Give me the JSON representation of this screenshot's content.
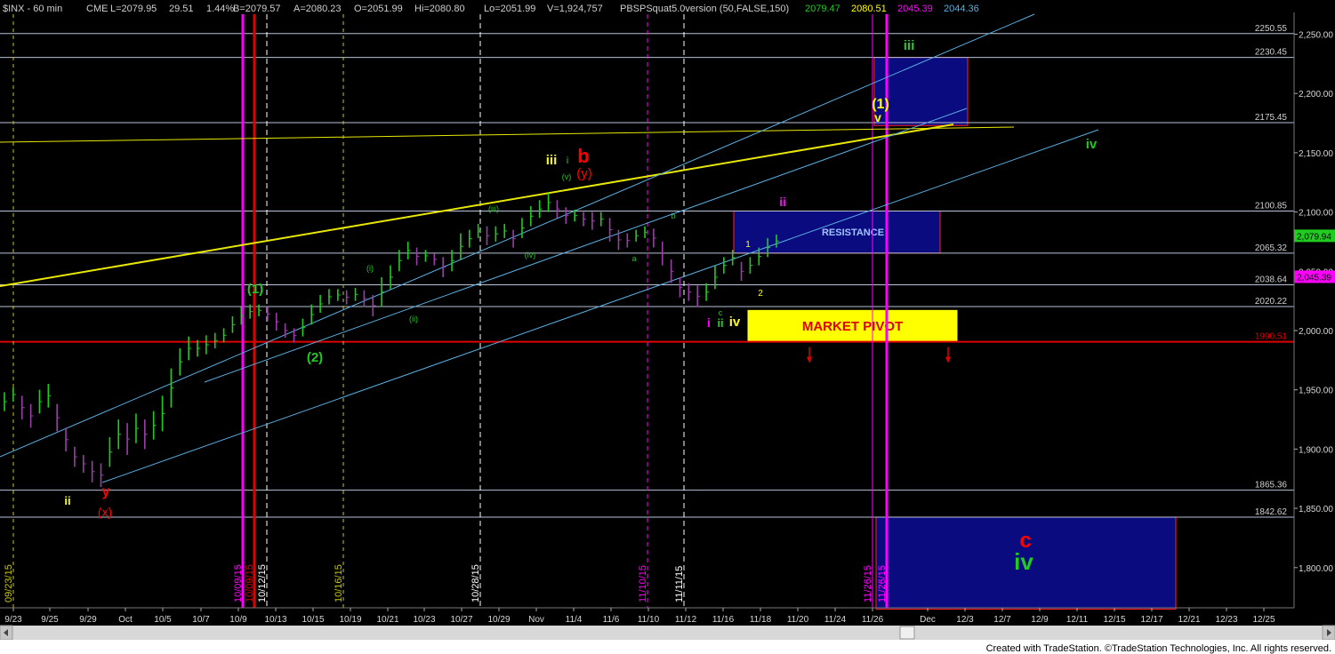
{
  "header": {
    "symbol": "$INX - 60 min",
    "exchange": "CME",
    "last": "L=2079.95",
    "change": "29.51",
    "pct": "1.44%",
    "bid": "B=2079.57",
    "ask": "A=2080.23",
    "open": "O=2051.99",
    "hi": "Hi=2080.80",
    "lo": "Lo=2051.99",
    "volume": "V=1,924,757",
    "indicator": "PBSPSquat5.0version (50,FALSE,150)",
    "ind_values": [
      "2079.47",
      "2080.51",
      "2045.39",
      "2044.36"
    ]
  },
  "footer": "Created with TradeStation. ©TradeStation Technologies, Inc. All rights reserved.",
  "colors": {
    "background": "#000000",
    "price_up": "#1fcc1f",
    "price_down": "#9a3fa8",
    "level_line": "#b8c4d6",
    "red_line": "#e00000",
    "channel": "#5aaee0",
    "yellow": "#ffff00",
    "magenta": "#ff00ff",
    "box_fill": "#0b0b80",
    "box_border": "#ff2020"
  },
  "chart_data": {
    "type": "candlestick",
    "title": "$INX - 60 min",
    "ylim": [
      1762,
      2270
    ],
    "y_ticks": [
      "2,250.00",
      "2,200.00",
      "2,150.00",
      "2,100.00",
      "2,050.00",
      "2,000.00",
      "1,950.00",
      "1,900.00",
      "1,850.00",
      "1,800.00"
    ],
    "x_ticks": [
      "9/23",
      "9/25",
      "9/29",
      "Oct",
      "10/5",
      "10/7",
      "10/9",
      "10/13",
      "10/15",
      "10/19",
      "10/21",
      "10/23",
      "10/27",
      "10/29",
      "Nov",
      "11/4",
      "11/6",
      "11/10",
      "11/12",
      "11/16",
      "11/18",
      "11/20",
      "11/24",
      "11/26",
      "Dec",
      "12/3",
      "12/7",
      "12/9",
      "12/11",
      "12/15",
      "12/17",
      "12/21",
      "12/23",
      "12/25"
    ],
    "horizontal_levels": [
      {
        "value": 2250.55,
        "label": "2250.55"
      },
      {
        "value": 2230.45,
        "label": "2230.45"
      },
      {
        "value": 2175.45,
        "label": "2175.45"
      },
      {
        "value": 2100.85,
        "label": "2100.85"
      },
      {
        "value": 2065.32,
        "label": "2065.32"
      },
      {
        "value": 2038.64,
        "label": "2038.64"
      },
      {
        "value": 2020.22,
        "label": "2020.22"
      },
      {
        "value": 1990.51,
        "label": "1990.51",
        "color": "red"
      },
      {
        "value": 1865.36,
        "label": "1865.36"
      },
      {
        "value": 1842.62,
        "label": "1842.62"
      }
    ],
    "last_price_tags": [
      {
        "value": 2079.94,
        "label": "2,079.94",
        "color": "#1fcc1f"
      },
      {
        "value": 2045.39,
        "label": "2,045.39",
        "color": "#ff00ff"
      }
    ],
    "date_markers": [
      {
        "label": "09/23/15",
        "color": "yellow"
      },
      {
        "label": "10/09/15",
        "color": "magenta"
      },
      {
        "label": "10/09/15",
        "color": "red"
      },
      {
        "label": "10/12/15",
        "color": "white"
      },
      {
        "label": "10/16/15",
        "color": "yellow"
      },
      {
        "label": "10/28/15",
        "color": "white"
      },
      {
        "label": "11/10/15",
        "color": "magenta"
      },
      {
        "label": "11/11/15",
        "color": "white"
      },
      {
        "label": "11/26/15",
        "color": "magenta"
      },
      {
        "label": "11/26/15",
        "color": "magenta"
      }
    ],
    "zones": [
      {
        "label": "RESISTANCE",
        "from": 2065.32,
        "to": 2100.85
      },
      {
        "label": "MARKET PIVOT",
        "from": 1990.51,
        "to": 2017
      },
      {
        "label": "",
        "from": 2173,
        "to": 2230.45
      },
      {
        "label": "",
        "from": 1765,
        "to": 1842.62
      }
    ],
    "price_path": [
      {
        "x": 0,
        "low": 1932,
        "high": 1948
      },
      {
        "x": 1,
        "low": 1940,
        "high": 1952
      },
      {
        "x": 2,
        "low": 1925,
        "high": 1945
      },
      {
        "x": 3,
        "low": 1918,
        "high": 1938
      },
      {
        "x": 4,
        "low": 1930,
        "high": 1950
      },
      {
        "x": 5,
        "low": 1935,
        "high": 1955
      },
      {
        "x": 6,
        "low": 1915,
        "high": 1938
      },
      {
        "x": 7,
        "low": 1898,
        "high": 1918
      },
      {
        "x": 8,
        "low": 1885,
        "high": 1902
      },
      {
        "x": 9,
        "low": 1880,
        "high": 1895
      },
      {
        "x": 10,
        "low": 1872,
        "high": 1890
      },
      {
        "x": 11,
        "low": 1868,
        "high": 1888
      },
      {
        "x": 12,
        "low": 1885,
        "high": 1910
      },
      {
        "x": 13,
        "low": 1900,
        "high": 1925
      },
      {
        "x": 14,
        "low": 1895,
        "high": 1922
      },
      {
        "x": 15,
        "low": 1905,
        "high": 1930
      },
      {
        "x": 16,
        "low": 1900,
        "high": 1925
      },
      {
        "x": 17,
        "low": 1908,
        "high": 1932
      },
      {
        "x": 18,
        "low": 1915,
        "high": 1945
      },
      {
        "x": 19,
        "low": 1935,
        "high": 1968
      },
      {
        "x": 20,
        "low": 1962,
        "high": 1985
      },
      {
        "x": 21,
        "low": 1975,
        "high": 1995
      },
      {
        "x": 22,
        "low": 1978,
        "high": 1992
      },
      {
        "x": 23,
        "low": 1980,
        "high": 1996
      },
      {
        "x": 24,
        "low": 1985,
        "high": 1998
      },
      {
        "x": 25,
        "low": 1990,
        "high": 2002
      },
      {
        "x": 26,
        "low": 1998,
        "high": 2012
      },
      {
        "x": 27,
        "low": 2005,
        "high": 2020
      },
      {
        "x": 28,
        "low": 2010,
        "high": 2022
      },
      {
        "x": 29,
        "low": 2012,
        "high": 2022
      },
      {
        "x": 30,
        "low": 2008,
        "high": 2020
      },
      {
        "x": 31,
        "low": 2000,
        "high": 2015
      },
      {
        "x": 32,
        "low": 1994,
        "high": 2006
      },
      {
        "x": 33,
        "low": 1990,
        "high": 2002
      },
      {
        "x": 34,
        "low": 1995,
        "high": 2010
      },
      {
        "x": 35,
        "low": 2005,
        "high": 2022
      },
      {
        "x": 36,
        "low": 2015,
        "high": 2030
      },
      {
        "x": 37,
        "low": 2022,
        "high": 2035
      },
      {
        "x": 38,
        "low": 2025,
        "high": 2035
      },
      {
        "x": 39,
        "low": 2022,
        "high": 2034
      },
      {
        "x": 40,
        "low": 2025,
        "high": 2036
      },
      {
        "x": 41,
        "low": 2020,
        "high": 2034
      },
      {
        "x": 42,
        "low": 2012,
        "high": 2030
      },
      {
        "x": 43,
        "low": 2020,
        "high": 2045
      },
      {
        "x": 44,
        "low": 2035,
        "high": 2055
      },
      {
        "x": 45,
        "low": 2050,
        "high": 2068
      },
      {
        "x": 46,
        "low": 2060,
        "high": 2075
      },
      {
        "x": 47,
        "low": 2055,
        "high": 2070
      },
      {
        "x": 48,
        "low": 2058,
        "high": 2068
      },
      {
        "x": 49,
        "low": 2055,
        "high": 2065
      },
      {
        "x": 50,
        "low": 2045,
        "high": 2062
      },
      {
        "x": 51,
        "low": 2050,
        "high": 2068
      },
      {
        "x": 52,
        "low": 2060,
        "high": 2082
      },
      {
        "x": 53,
        "low": 2070,
        "high": 2085
      },
      {
        "x": 54,
        "low": 2078,
        "high": 2090
      },
      {
        "x": 55,
        "low": 2072,
        "high": 2088
      },
      {
        "x": 56,
        "low": 2075,
        "high": 2088
      },
      {
        "x": 57,
        "low": 2078,
        "high": 2090
      },
      {
        "x": 58,
        "low": 2070,
        "high": 2085
      },
      {
        "x": 59,
        "low": 2078,
        "high": 2095
      },
      {
        "x": 60,
        "low": 2088,
        "high": 2105
      },
      {
        "x": 61,
        "low": 2095,
        "high": 2110
      },
      {
        "x": 62,
        "low": 2100,
        "high": 2116
      },
      {
        "x": 63,
        "low": 2095,
        "high": 2110
      },
      {
        "x": 64,
        "low": 2090,
        "high": 2104
      },
      {
        "x": 65,
        "low": 2092,
        "high": 2102
      },
      {
        "x": 66,
        "low": 2088,
        "high": 2100
      },
      {
        "x": 67,
        "low": 2085,
        "high": 2100
      },
      {
        "x": 68,
        "low": 2088,
        "high": 2100
      },
      {
        "x": 69,
        "low": 2075,
        "high": 2095
      },
      {
        "x": 70,
        "low": 2068,
        "high": 2085
      },
      {
        "x": 71,
        "low": 2070,
        "high": 2082
      },
      {
        "x": 72,
        "low": 2075,
        "high": 2085
      },
      {
        "x": 73,
        "low": 2078,
        "high": 2088
      },
      {
        "x": 74,
        "low": 2070,
        "high": 2086
      },
      {
        "x": 75,
        "low": 2055,
        "high": 2075
      },
      {
        "x": 76,
        "low": 2040,
        "high": 2060
      },
      {
        "x": 77,
        "low": 2028,
        "high": 2045
      },
      {
        "x": 78,
        "low": 2025,
        "high": 2040
      },
      {
        "x": 79,
        "low": 2020,
        "high": 2038
      },
      {
        "x": 80,
        "low": 2025,
        "high": 2040
      },
      {
        "x": 81,
        "low": 2035,
        "high": 2055
      },
      {
        "x": 82,
        "low": 2048,
        "high": 2062
      },
      {
        "x": 83,
        "low": 2055,
        "high": 2068
      },
      {
        "x": 84,
        "low": 2042,
        "high": 2058
      },
      {
        "x": 85,
        "low": 2048,
        "high": 2062
      },
      {
        "x": 86,
        "low": 2055,
        "high": 2070
      },
      {
        "x": 87,
        "low": 2062,
        "high": 2078
      },
      {
        "x": 88,
        "low": 2070,
        "high": 2081
      }
    ],
    "wave_labels": [
      {
        "text": "ii",
        "color": "yellow"
      },
      {
        "text": "y",
        "color": "red"
      },
      {
        "text": "(x)",
        "color": "red"
      },
      {
        "text": "(1)",
        "color": "#1fcc1f"
      },
      {
        "text": "(2)",
        "color": "#1fcc1f"
      },
      {
        "text": "(i)",
        "color": "#1fcc1f"
      },
      {
        "text": "(ii)",
        "color": "#1fcc1f"
      },
      {
        "text": "(iii)",
        "color": "#1fcc1f"
      },
      {
        "text": "(iv)",
        "color": "#1fcc1f"
      },
      {
        "text": "(v)",
        "color": "#1fcc1f"
      },
      {
        "text": "iii",
        "color": "yellow"
      },
      {
        "text": "i",
        "color": "#1fcc1f"
      },
      {
        "text": "b",
        "color": "red"
      },
      {
        "text": "(y)",
        "color": "red"
      },
      {
        "text": "a",
        "color": "#1fcc1f"
      },
      {
        "text": "b",
        "color": "#1fcc1f"
      },
      {
        "text": "c",
        "color": "#1fcc1f"
      },
      {
        "text": "i",
        "color": "magenta"
      },
      {
        "text": "ii",
        "color": "#1fcc1f"
      },
      {
        "text": "iv",
        "color": "yellow"
      },
      {
        "text": "1",
        "color": "yellow"
      },
      {
        "text": "2",
        "color": "yellow"
      },
      {
        "text": "ii",
        "color": "magenta"
      },
      {
        "text": "(1)",
        "color": "yellow"
      },
      {
        "text": "v",
        "color": "yellow"
      },
      {
        "text": "iii",
        "color": "#1fcc1f"
      },
      {
        "text": "iv",
        "color": "#1fcc1f"
      },
      {
        "text": "c",
        "color": "red"
      },
      {
        "text": "iv",
        "color": "#1fcc1f"
      }
    ]
  }
}
